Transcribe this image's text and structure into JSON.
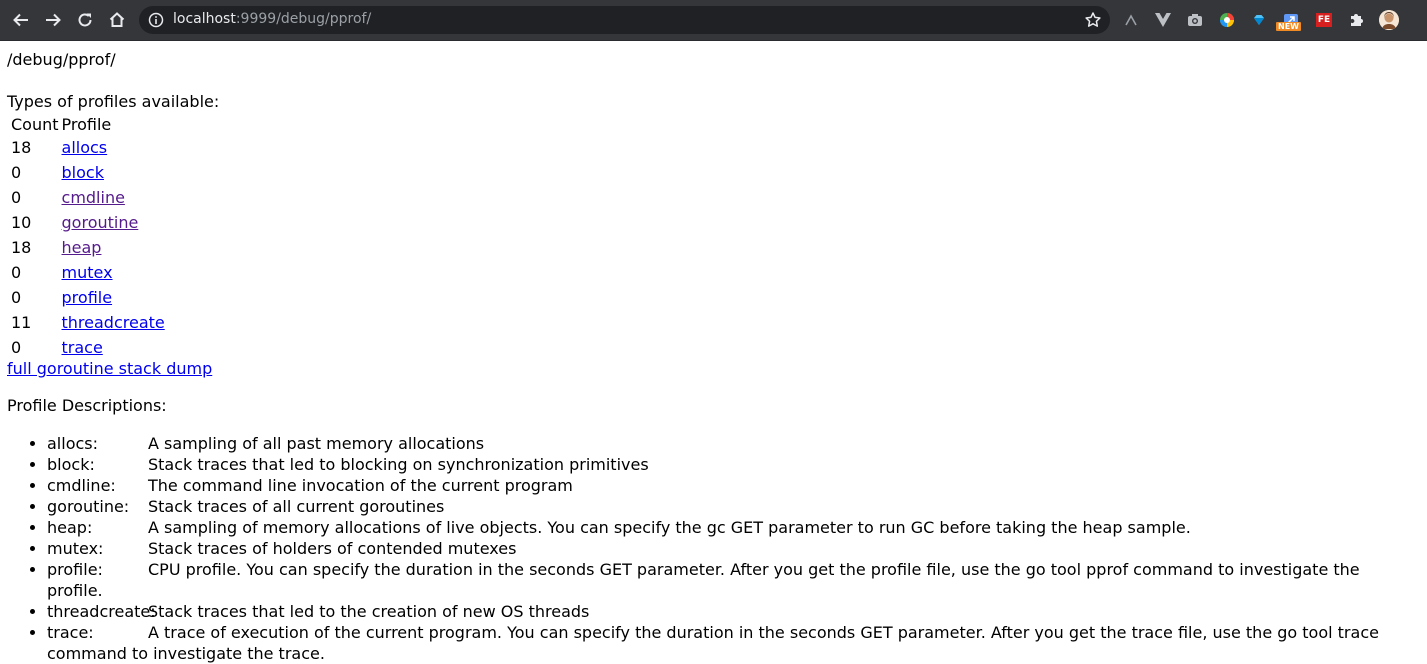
{
  "browser": {
    "url_host": "localhost",
    "url_rest": ":9999/debug/pprof/",
    "ext_new_badge": "NEW",
    "ext_fe_label": "FE"
  },
  "page": {
    "title": "/debug/pprof/",
    "types_heading": "Types of profiles available:",
    "table": {
      "headers": [
        "Count",
        "Profile"
      ],
      "rows": [
        {
          "count": "18",
          "profile": "allocs"
        },
        {
          "count": "0",
          "profile": "block"
        },
        {
          "count": "0",
          "profile": "cmdline"
        },
        {
          "count": "10",
          "profile": "goroutine"
        },
        {
          "count": "18",
          "profile": "heap"
        },
        {
          "count": "0",
          "profile": "mutex"
        },
        {
          "count": "0",
          "profile": "profile"
        },
        {
          "count": "11",
          "profile": "threadcreate"
        },
        {
          "count": "0",
          "profile": "trace"
        }
      ]
    },
    "full_dump_link": "full goroutine stack dump",
    "descriptions_heading": "Profile Descriptions:",
    "descriptions": [
      {
        "key": "allocs:",
        "text": "A sampling of all past memory allocations"
      },
      {
        "key": "block:",
        "text": "Stack traces that led to blocking on synchronization primitives"
      },
      {
        "key": "cmdline:",
        "text": "The command line invocation of the current program"
      },
      {
        "key": "goroutine:",
        "text": "Stack traces of all current goroutines"
      },
      {
        "key": "heap:",
        "text": "A sampling of memory allocations of live objects. You can specify the gc GET parameter to run GC before taking the heap sample."
      },
      {
        "key": "mutex:",
        "text": "Stack traces of holders of contended mutexes"
      },
      {
        "key": "profile:",
        "text": "CPU profile. You can specify the duration in the seconds GET parameter. After you get the profile file, use the go tool pprof command to investigate the profile."
      },
      {
        "key": "threadcreate:",
        "text": "Stack traces that led to the creation of new OS threads"
      },
      {
        "key": "trace:",
        "text": "A trace of execution of the current program. You can specify the duration in the seconds GET parameter. After you get the trace file, use the go tool trace command to investigate the trace."
      }
    ]
  }
}
